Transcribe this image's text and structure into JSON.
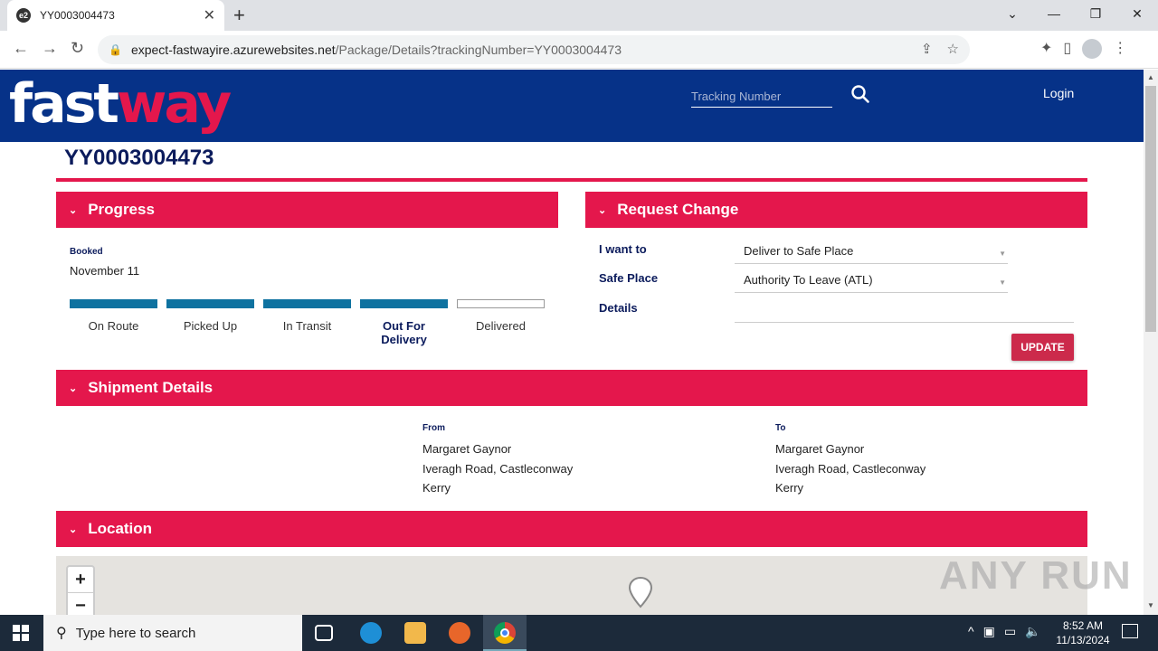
{
  "browser": {
    "tab_title": "YY0003004473",
    "tab_favicon": "e2",
    "url_host": "expect-fastwayire.azurewebsites.net",
    "url_path": "/Package/Details?trackingNumber=YY0003004473"
  },
  "header": {
    "logo_fast": "fast",
    "logo_way": "way",
    "tracking_placeholder": "Tracking Number",
    "login_label": "Login"
  },
  "package": {
    "tracking_number": "YY0003004473"
  },
  "progress": {
    "title": "Progress",
    "booked_label": "Booked",
    "booked_date": "November 11",
    "steps": [
      {
        "label": "On Route",
        "done": true
      },
      {
        "label": "Picked Up",
        "done": true
      },
      {
        "label": "In Transit",
        "done": true
      },
      {
        "label": "Out For Delivery",
        "done": true,
        "current": true
      },
      {
        "label": "Delivered",
        "done": false
      }
    ]
  },
  "request_change": {
    "title": "Request Change",
    "i_want_to_label": "I want to",
    "i_want_to_value": "Deliver to Safe Place",
    "safe_place_label": "Safe Place",
    "safe_place_value": "Authority To Leave (ATL)",
    "details_label": "Details",
    "update_label": "UPDATE"
  },
  "shipment": {
    "title": "Shipment Details",
    "from": {
      "label": "From",
      "name": "Margaret Gaynor",
      "street": "Iveragh Road, Castleconway",
      "county": "Kerry"
    },
    "to": {
      "label": "To",
      "name": "Margaret Gaynor",
      "street": "Iveragh Road, Castleconway",
      "county": "Kerry"
    }
  },
  "location": {
    "title": "Location",
    "zoom_in": "+",
    "zoom_out": "−"
  },
  "watermark": "ANY RUN",
  "taskbar": {
    "search_placeholder": "Type here to search",
    "time": "8:52 AM",
    "date": "11/13/2024"
  },
  "colors": {
    "brand_blue": "#063288",
    "brand_red": "#e4174c",
    "progress_done": "#0e72a0"
  }
}
